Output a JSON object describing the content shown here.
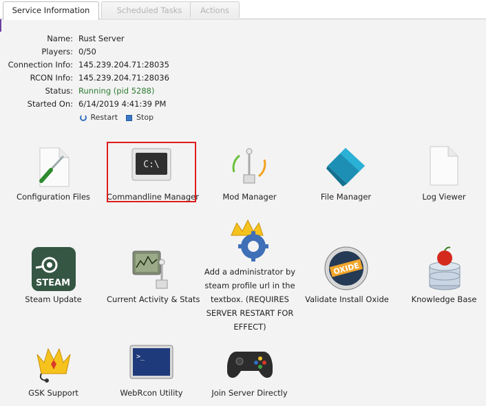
{
  "tabs": [
    {
      "label": "Service Information",
      "active": true
    },
    {
      "label": "Scheduled Tasks",
      "active": false
    },
    {
      "label": "Actions",
      "active": false
    }
  ],
  "info": {
    "name_label": "Name:",
    "name": "Rust Server",
    "players_label": "Players:",
    "players": "0/50",
    "conn_label": "Connection Info:",
    "conn": "145.239.204.71:28035",
    "rcon_label": "RCON Info:",
    "rcon": "145.239.204.71:28036",
    "status_label": "Status:",
    "status": "Running (pid 5288)",
    "started_label": "Started On:",
    "started": "6/14/2019 4:41:39 PM"
  },
  "service_actions": {
    "restart": "Restart",
    "stop": "Stop"
  },
  "tools": {
    "config": "Configuration Files",
    "cmd": "Commandline Manager",
    "cmd_text": "C:\\",
    "mod": "Mod Manager",
    "file": "File Manager",
    "log": "Log Viewer",
    "steam": "Steam Update",
    "steam_text": "STEAM",
    "activity": "Current Activity & Stats",
    "admin_lines": [
      "Add a administrator by",
      "steam profile url in the",
      "textbox. (REQUIRES",
      "SERVER RESTART FOR",
      "EFFECT)"
    ],
    "oxide": "Validate Install Oxide",
    "oxide_text": "OXIDE",
    "kb": "Knowledge Base",
    "gsk": "GSK Support",
    "webrcon": "WebRcon Utility",
    "join": "Join Server Directly"
  },
  "colors": {
    "highlight": "#e01a1a",
    "status_running": "#2e7d32",
    "tab_border": "#c9c9c9"
  }
}
